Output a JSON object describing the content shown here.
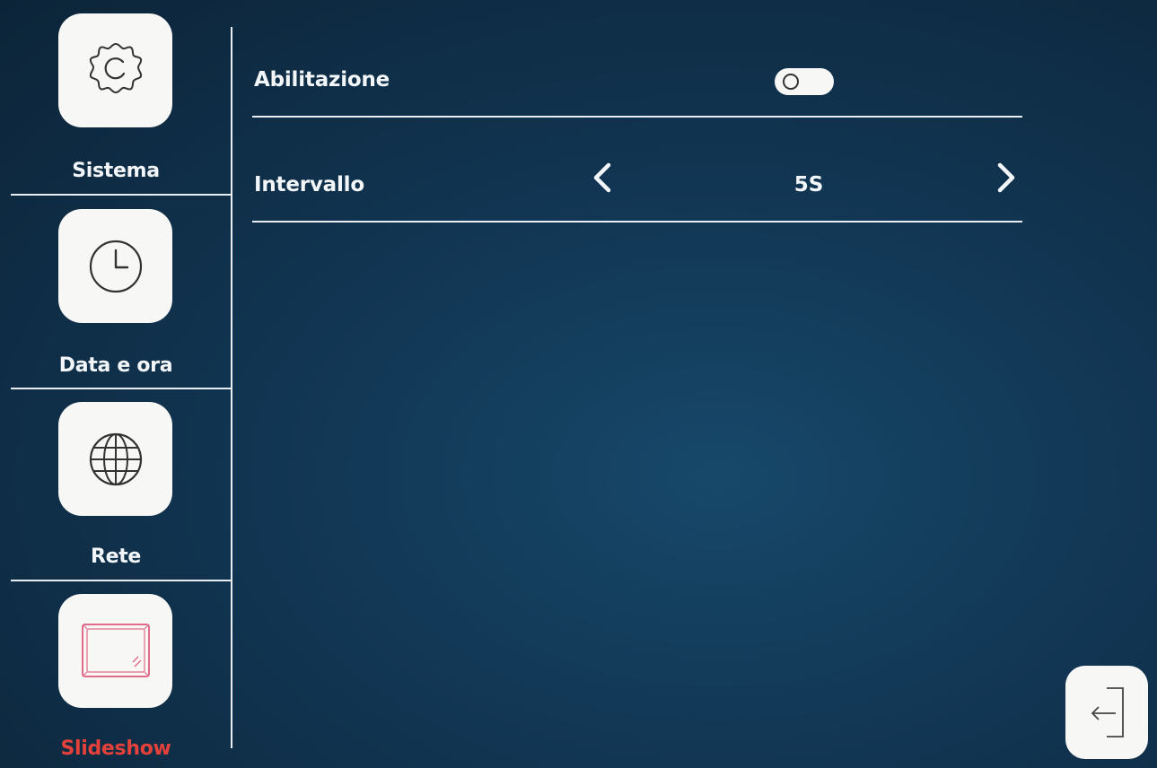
{
  "sidebar": {
    "items": [
      {
        "label": "Sistema",
        "icon": "gear-icon",
        "active": false
      },
      {
        "label": "Data e ora",
        "icon": "clock-icon",
        "active": false
      },
      {
        "label": "Rete",
        "icon": "globe-icon",
        "active": false
      },
      {
        "label": "Slideshow",
        "icon": "picture-frame-icon",
        "active": true
      }
    ]
  },
  "settings": {
    "enable": {
      "label": "Abilitazione",
      "state": "off"
    },
    "interval": {
      "label": "Intervallo",
      "value": "5S"
    }
  },
  "exit_button": {
    "icon": "exit-arrow-icon"
  },
  "colors": {
    "background": "#113552",
    "tile": "#f7f7f5",
    "text": "#f3f6f8",
    "active_label": "#e4413b",
    "frame_icon": "#e06c8a"
  }
}
